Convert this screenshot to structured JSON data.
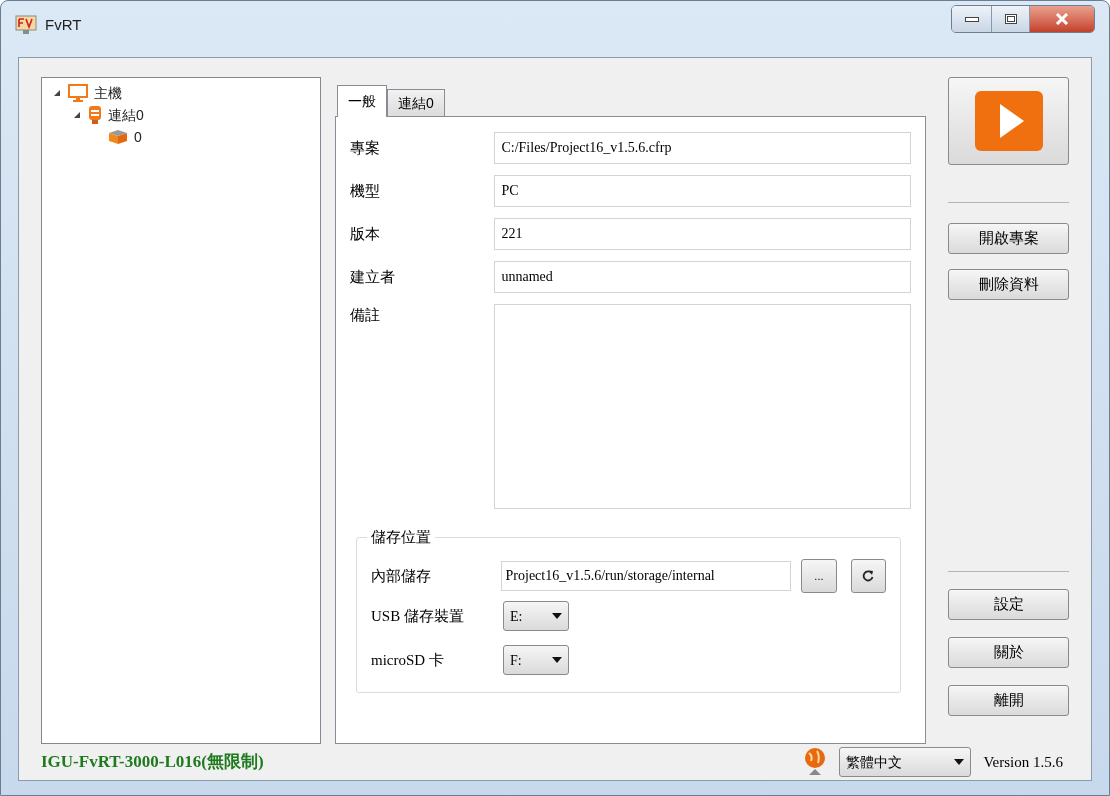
{
  "window": {
    "title": "FvRT"
  },
  "tree": [
    {
      "label": "主機",
      "kind": "host",
      "expanded": true,
      "children": [
        {
          "label": "連結0",
          "kind": "link",
          "expanded": true,
          "children": [
            {
              "label": "0",
              "kind": "device"
            }
          ]
        }
      ]
    }
  ],
  "tabs": [
    {
      "label": "一般",
      "selected": true
    },
    {
      "label": "連結0",
      "selected": false
    }
  ],
  "fields": [
    {
      "label": "專案",
      "value": "C:/Files/Project16_v1.5.6.cfrp"
    },
    {
      "label": "機型",
      "value": "PC"
    },
    {
      "label": "版本",
      "value": "221"
    },
    {
      "label": "建立者",
      "value": "unnamed"
    }
  ],
  "notes": {
    "label": "備註"
  },
  "storage": {
    "title": "儲存位置",
    "internal": {
      "label": "內部儲存",
      "value": "Project16_v1.5.6/run/storage/internal",
      "browse": "..."
    },
    "usb": {
      "label": "USB 儲存裝置",
      "value": "E:"
    },
    "microsd": {
      "label": "microSD 卡",
      "value": "F:"
    }
  },
  "actions_top": [
    "開啟專案",
    "刪除資料"
  ],
  "actions_bottom": [
    "設定",
    "關於",
    "離開"
  ],
  "license": "IGU-FvRT-3000-L016(無限制)",
  "language": "繁體中文",
  "version": "Version 1.5.6"
}
